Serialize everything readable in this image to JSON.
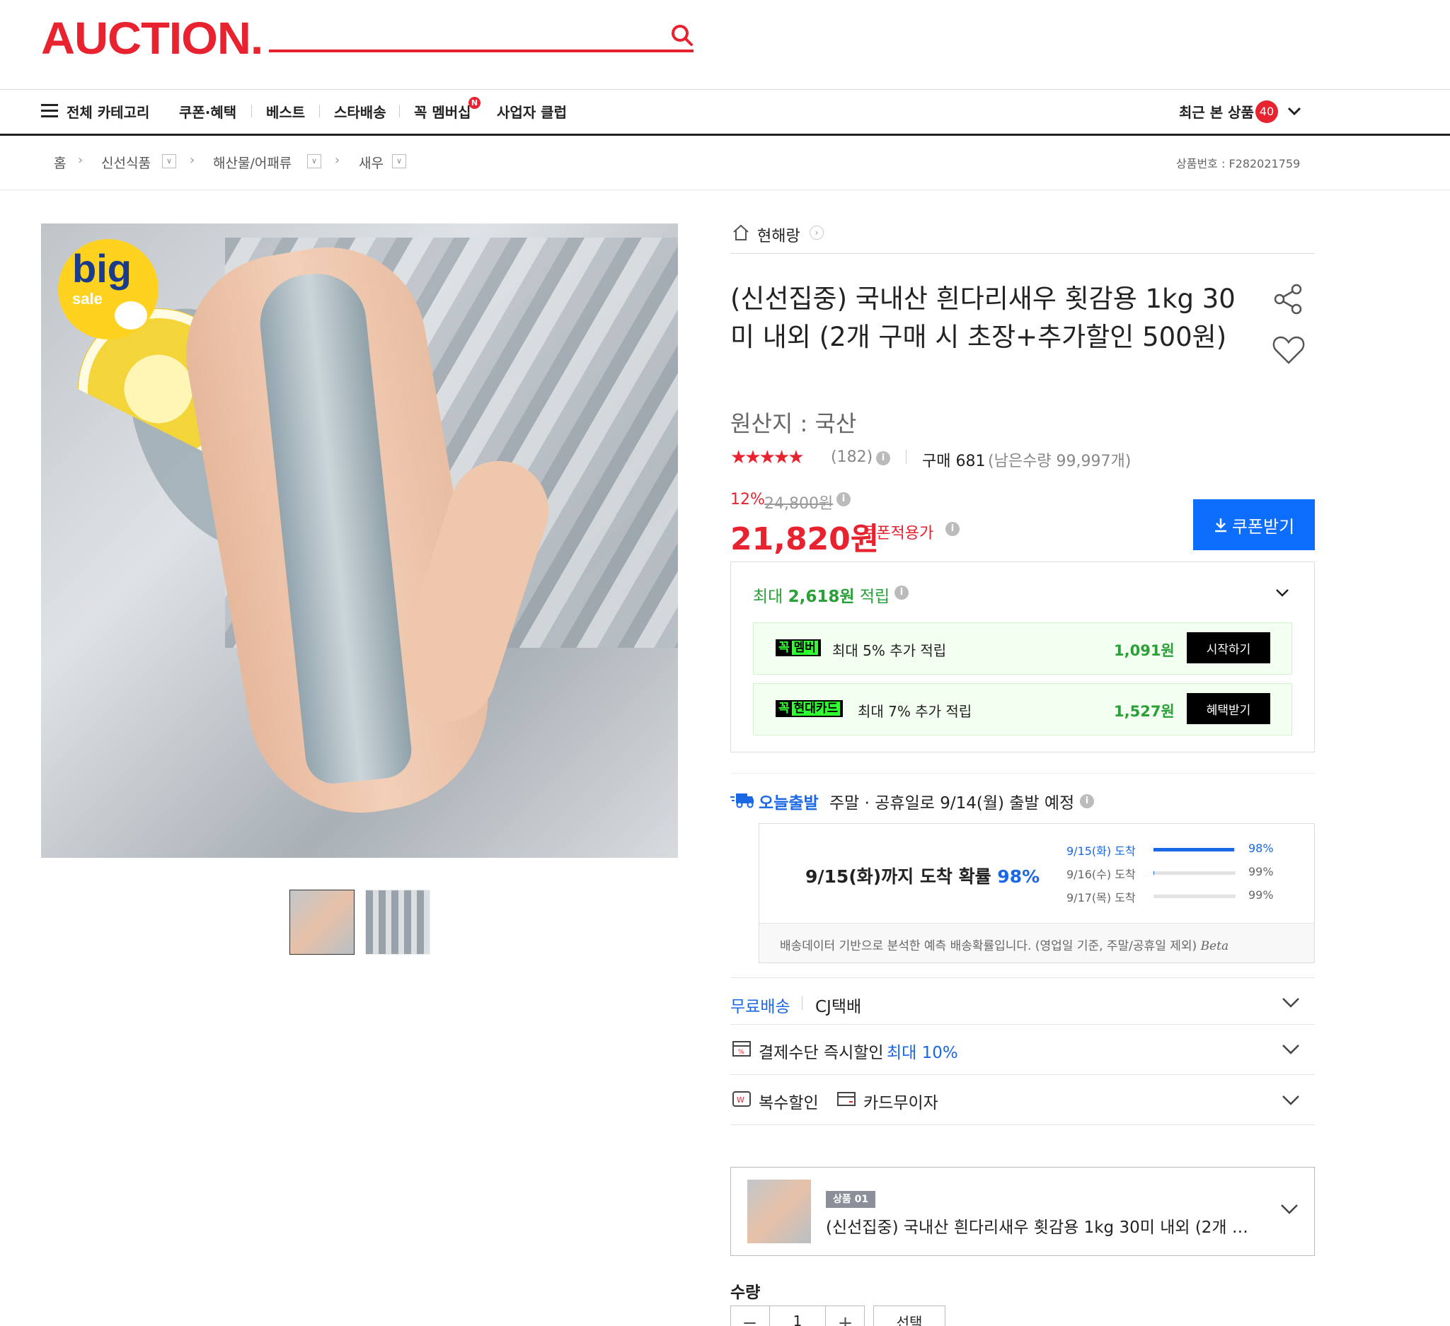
{
  "header": {
    "logo": "AUCTION.",
    "search": {
      "value": "",
      "placeholder": ""
    }
  },
  "nav": {
    "all_categories": "전체 카테고리",
    "items": [
      "쿠폰·혜택",
      "베스트",
      "스타배송",
      "꼭 멤버십",
      "사업자 클럽"
    ],
    "new_badge": "N",
    "recent_label": "최근 본 상품",
    "recent_count": "40"
  },
  "breadcrumb": {
    "home": "홈",
    "levels": [
      "신선식품",
      "해산물/어패류",
      "새우"
    ],
    "product_no": "상품번호 : F282021759"
  },
  "product": {
    "seller": "현해랑",
    "title": "(신선집중) 국내산 흰다리새우 횟감용 1kg 30미 내외 (2개 구매 시 초장+추가할인 500원)",
    "origin": "원산지 : 국산",
    "stars": "★★★★★",
    "rating_value": 4.5,
    "review_count": "(182)",
    "purchase_count": "구매 681",
    "remaining": "(남은수량 99,997개)",
    "discount_rate": "12%",
    "original_price": "24,800원",
    "price": "21,820원",
    "coupon_price_label": "쿠폰적용가",
    "coupon_button": "쿠폰받기",
    "image_badge_big": "big",
    "image_badge_sale": "sale"
  },
  "reward": {
    "title_prefix": "최대",
    "title_amount": "2,618원",
    "title_suffix": "적립",
    "rows": [
      {
        "badge_prefix": "꼭",
        "badge": "멤버",
        "text": "최대 5% 추가 적립",
        "amount": "1,091원",
        "button": "시작하기"
      },
      {
        "badge_prefix": "꼭",
        "badge": "현대카드",
        "text": "최대 7% 추가 적립",
        "amount": "1,527원",
        "button": "혜택받기"
      }
    ]
  },
  "shipping": {
    "today": "오늘출발",
    "note": "주말 · 공휴일로 9/14(월) 출발 예정",
    "arrival_main": "9/15(화)까지 도착 확률",
    "arrival_main_pct": "98%",
    "arrivals": [
      {
        "label": "9/15(화) 도착",
        "pct": "98%",
        "value": 0.98
      },
      {
        "label": "9/16(수) 도착",
        "pct": "99%",
        "value": 0.01
      },
      {
        "label": "9/17(목) 도착",
        "pct": "99%",
        "value": 0.0
      }
    ],
    "footnote": "배송데이터 기반으로 분석한 예측 배송확률입니다. (영업일 기준, 주말/공휴일 제외)",
    "beta": "Beta"
  },
  "options": {
    "free_ship": "무료배송",
    "courier": "CJ택배",
    "payment": "결제수단 즉시할인",
    "payment_max": "최대 10%",
    "multi_discount": "복수할인",
    "card_interest": "카드무이자"
  },
  "selected": {
    "badge": "상품 01",
    "name": "(신선집중) 국내산 흰다리새우 횟감용 1kg 30미 내외 (2개 구매 ..."
  },
  "quantity": {
    "label": "수량",
    "minus": "−",
    "value": "1",
    "plus": "+",
    "select": "선택"
  },
  "colors": {
    "brand_red": "#e8222f",
    "accent_blue": "#0d6efd",
    "reward_green": "#2aa137"
  }
}
